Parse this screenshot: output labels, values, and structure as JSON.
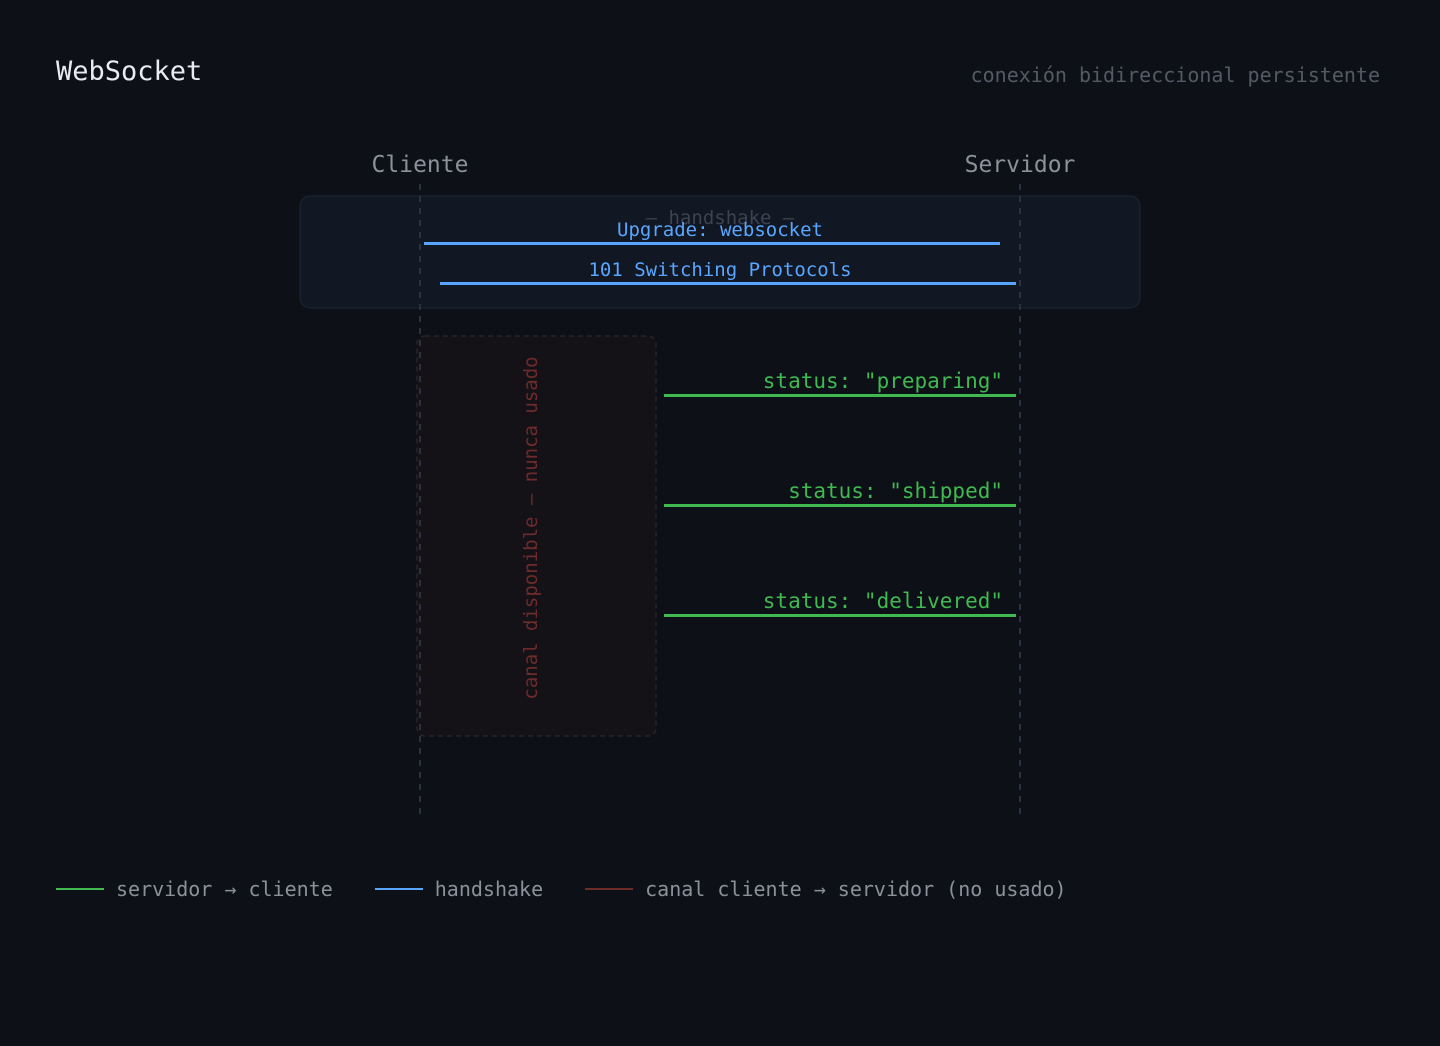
{
  "header": {
    "title": "WebSocket",
    "subtitle": "conexión bidireccional persistente"
  },
  "participants": {
    "client": "Cliente",
    "server": "Servidor"
  },
  "handshake": {
    "label": "— handshake —",
    "request": "Upgrade: websocket",
    "response": "101 Switching Protocols"
  },
  "unused_channel": {
    "label": "canal disponible — nunca usado"
  },
  "messages": [
    {
      "label": "status: \"preparing\""
    },
    {
      "label": "status: \"shipped\""
    },
    {
      "label": "status: \"delivered\""
    }
  ],
  "legend": [
    {
      "label": "servidor → cliente",
      "color": "#3fb950"
    },
    {
      "label": "handshake",
      "color": "#58a6ff"
    },
    {
      "label": "canal cliente → servidor (no usado)",
      "color": "#6e2b2b"
    }
  ],
  "colors": {
    "background": "#0d1017",
    "server_to_client": "#3fb950",
    "handshake": "#58a6ff",
    "unused": "#6e2b2b"
  }
}
